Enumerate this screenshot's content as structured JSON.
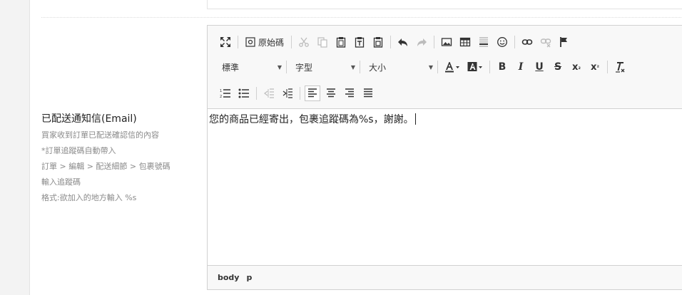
{
  "field": {
    "title": "已配送通知信(Email)",
    "help_lines": [
      "買家收到訂單已配送確認信的內容",
      "*訂單追蹤碼自動帶入",
      "訂單 > 編輯 > 配送細節 > 包裹號碼",
      "輸入追蹤碼",
      "格式:欲加入的地方輸入 %s"
    ]
  },
  "editor": {
    "source_label": "原始碼",
    "format_combo": "標準",
    "font_combo": "字型",
    "size_combo": "大小",
    "content": "您的商品已經寄出，包裹追蹤碼為%s，謝謝。",
    "path": [
      "body",
      "p"
    ]
  },
  "colors": {
    "accent": "#333333",
    "link_icon": "#8c8c8c"
  }
}
